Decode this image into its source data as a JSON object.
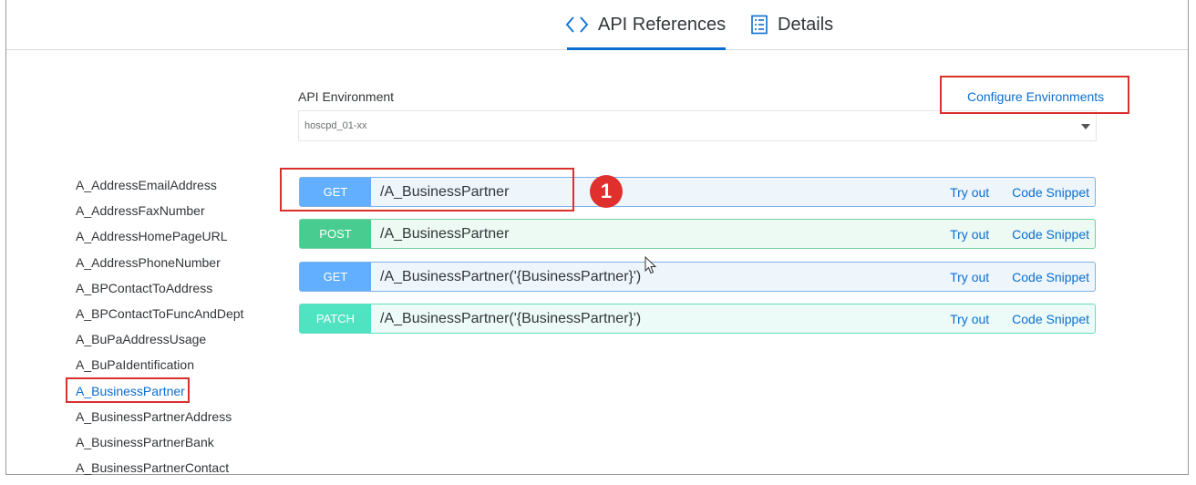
{
  "tabs": [
    {
      "label": "API References",
      "icon": "code-brackets-icon",
      "active": true
    },
    {
      "label": "Details",
      "icon": "document-list-icon",
      "active": false
    }
  ],
  "environment": {
    "label": "API Environment",
    "selected": "hoscpd_01-xx",
    "configure_link": "Configure Environments"
  },
  "sidebar": {
    "items": [
      "A_AddressEmailAddress",
      "A_AddressFaxNumber",
      "A_AddressHomePageURL",
      "A_AddressPhoneNumber",
      "A_BPContactToAddress",
      "A_BPContactToFuncAndDept",
      "A_BuPaAddressUsage",
      "A_BuPaIdentification",
      "A_BusinessPartner",
      "A_BusinessPartnerAddress",
      "A_BusinessPartnerBank",
      "A_BusinessPartnerContact"
    ],
    "active_item": "A_BusinessPartner"
  },
  "operations": [
    {
      "method": "GET",
      "path": "/A_BusinessPartner",
      "try_label": "Try out",
      "snippet_label": "Code Snippet"
    },
    {
      "method": "POST",
      "path": "/A_BusinessPartner",
      "try_label": "Try out",
      "snippet_label": "Code Snippet"
    },
    {
      "method": "GET",
      "path": "/A_BusinessPartner('{BusinessPartner}')",
      "try_label": "Try out",
      "snippet_label": "Code Snippet"
    },
    {
      "method": "PATCH",
      "path": "/A_BusinessPartner('{BusinessPartner}')",
      "try_label": "Try out",
      "snippet_label": "Code Snippet"
    }
  ],
  "annotation": {
    "step_number": "1"
  },
  "colors": {
    "accent": "#0a6ed1",
    "get": "#61affe",
    "post": "#49cc90",
    "patch": "#50e3c2",
    "highlight": "#d9302c"
  }
}
